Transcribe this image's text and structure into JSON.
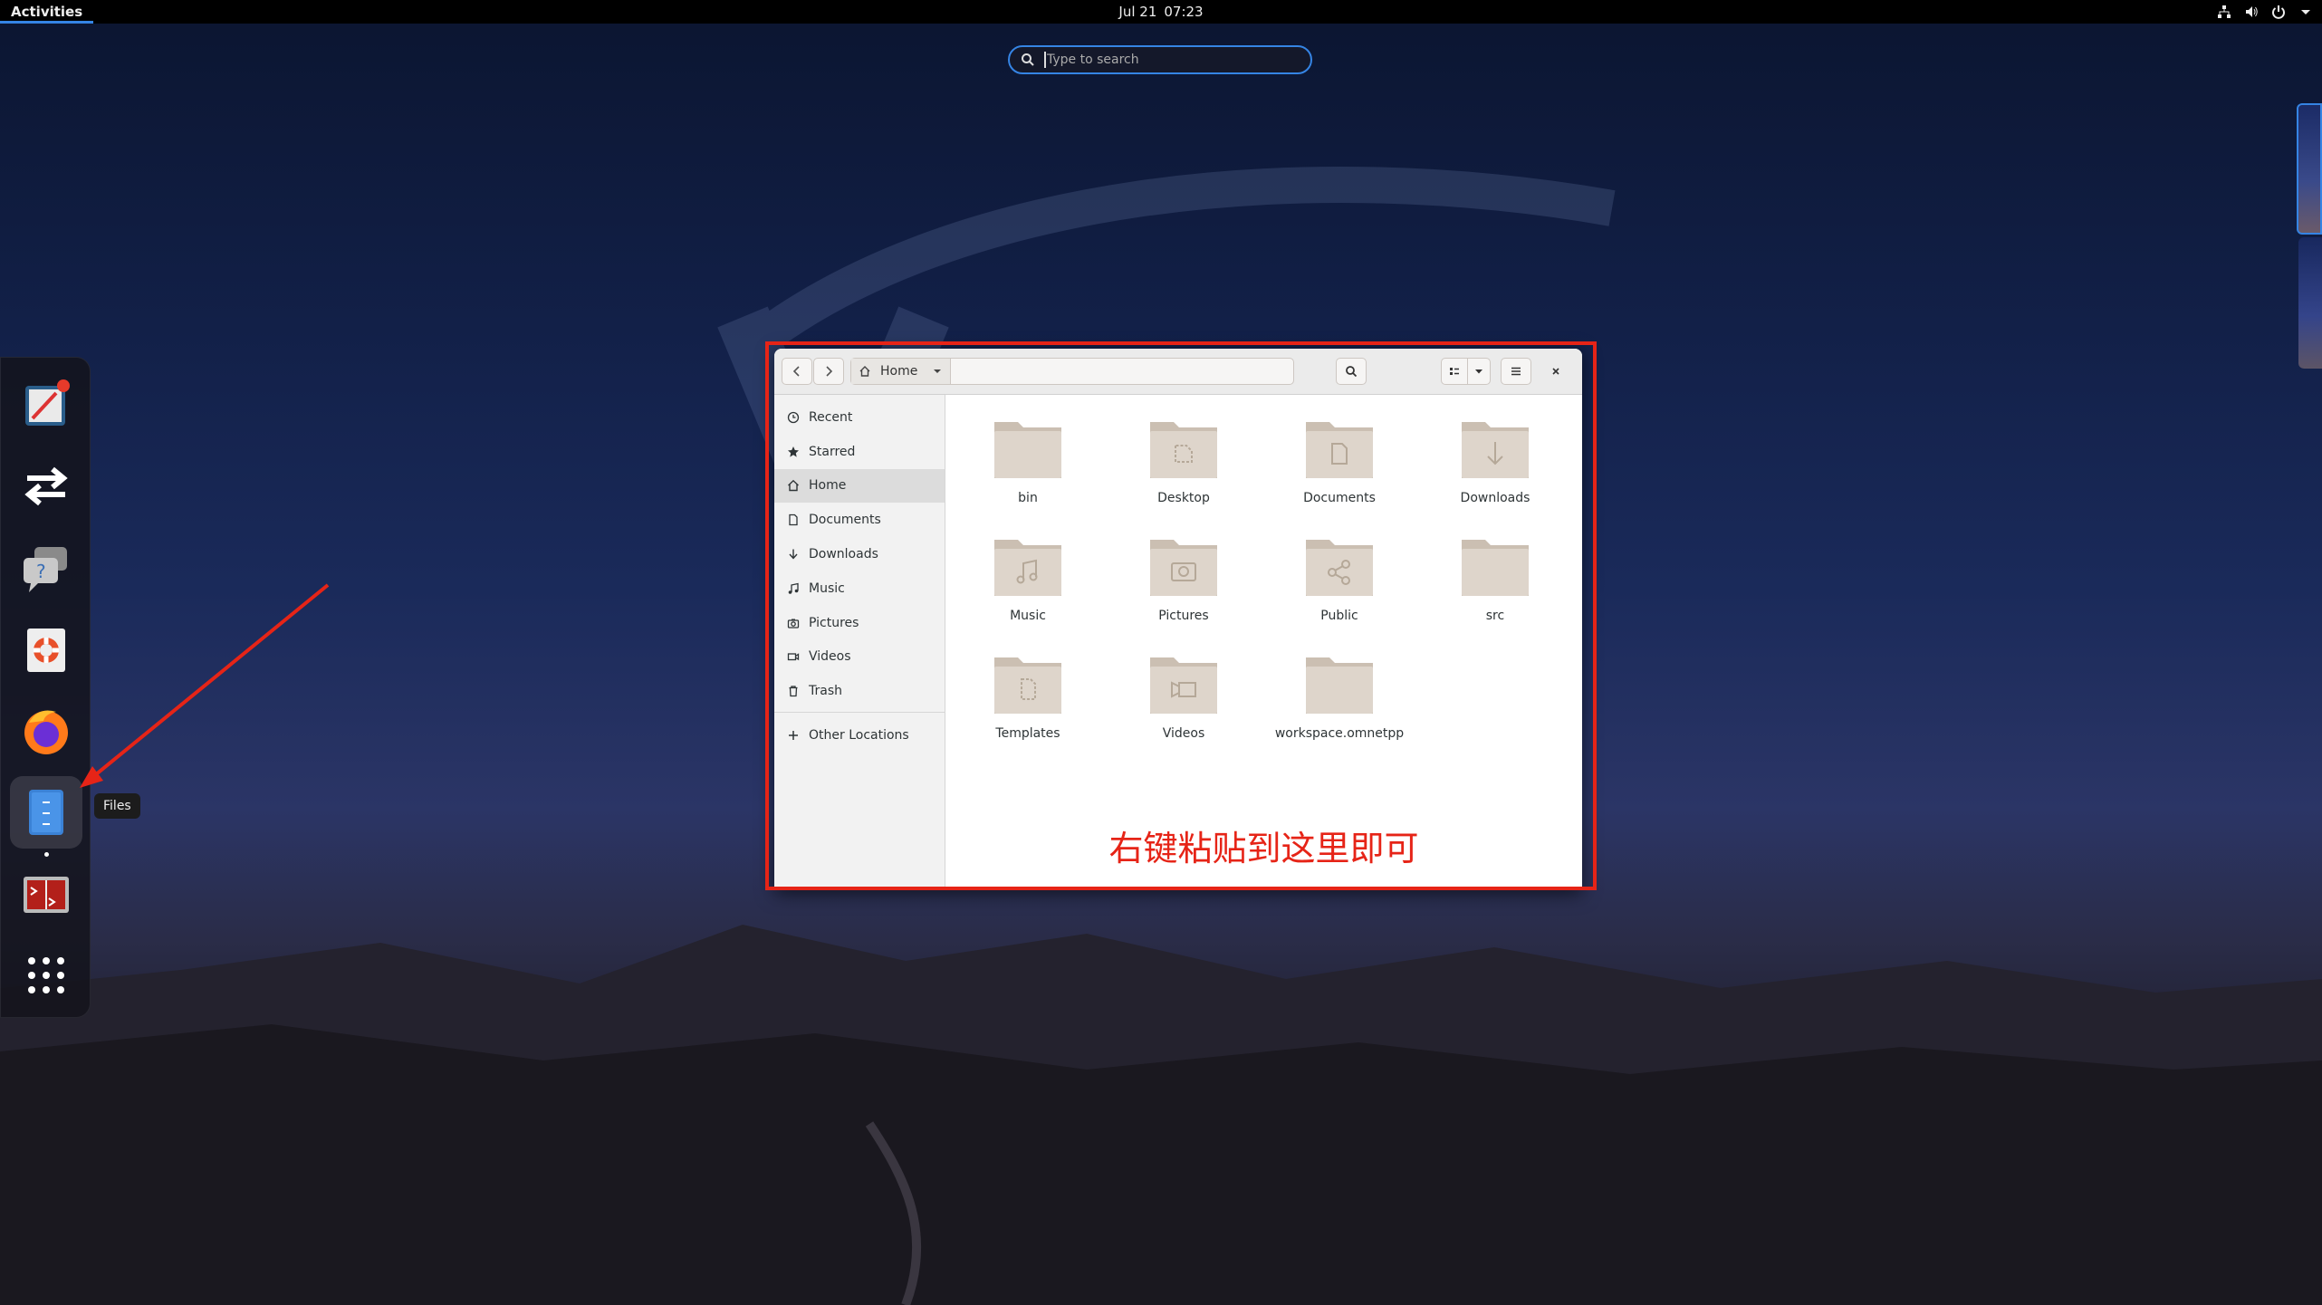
{
  "topbar": {
    "activities": "Activities",
    "date": "Jul 21",
    "time": "07:23"
  },
  "search": {
    "placeholder": "Type to search"
  },
  "dock": {
    "items": [
      {
        "name": "notes-app",
        "icon": "notes-icon",
        "running": false
      },
      {
        "name": "transfer-app",
        "icon": "transfer-arrows-icon",
        "running": false
      },
      {
        "name": "help-chat",
        "icon": "help-chat-icon",
        "running": false
      },
      {
        "name": "help-app",
        "icon": "lifebuoy-icon",
        "running": false
      },
      {
        "name": "firefox",
        "icon": "firefox-icon",
        "running": false
      },
      {
        "name": "files",
        "icon": "files-icon",
        "running": true
      },
      {
        "name": "terminal-app",
        "icon": "terminal-icon",
        "running": false
      },
      {
        "name": "app-grid",
        "icon": "app-grid-icon",
        "running": false
      }
    ],
    "tooltip": "Files"
  },
  "files_window": {
    "location": "Home",
    "sidebar": [
      {
        "label": "Recent",
        "icon": "clock-icon"
      },
      {
        "label": "Starred",
        "icon": "star-icon"
      },
      {
        "label": "Home",
        "icon": "home-icon",
        "selected": true
      },
      {
        "label": "Documents",
        "icon": "document-icon"
      },
      {
        "label": "Downloads",
        "icon": "download-icon"
      },
      {
        "label": "Music",
        "icon": "music-icon"
      },
      {
        "label": "Pictures",
        "icon": "camera-icon"
      },
      {
        "label": "Videos",
        "icon": "video-icon"
      },
      {
        "label": "Trash",
        "icon": "trash-icon"
      }
    ],
    "other_locations": "Other Locations",
    "folders": [
      {
        "label": "bin",
        "emblem": "none"
      },
      {
        "label": "Desktop",
        "emblem": "desktop"
      },
      {
        "label": "Documents",
        "emblem": "document"
      },
      {
        "label": "Downloads",
        "emblem": "download"
      },
      {
        "label": "Music",
        "emblem": "music"
      },
      {
        "label": "Pictures",
        "emblem": "camera"
      },
      {
        "label": "Public",
        "emblem": "share"
      },
      {
        "label": "src",
        "emblem": "none"
      },
      {
        "label": "Templates",
        "emblem": "template"
      },
      {
        "label": "Videos",
        "emblem": "video"
      },
      {
        "label": "workspace.omnetpp",
        "emblem": "none"
      }
    ]
  },
  "annotation": {
    "text": "右键粘贴到这里即可",
    "color": "#e62417"
  },
  "colors": {
    "accent": "#3584e4",
    "folder": "#d9cfc4",
    "highlight": "#e62417"
  }
}
